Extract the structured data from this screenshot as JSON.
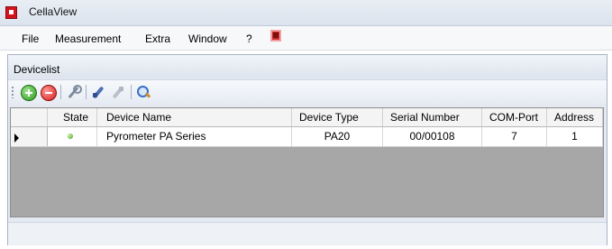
{
  "window": {
    "title": "CellaView"
  },
  "menu": {
    "items": [
      {
        "label": "File"
      },
      {
        "label": "Measurement"
      },
      {
        "label": "Extra"
      },
      {
        "label": "Window"
      },
      {
        "label": "?"
      }
    ],
    "app_icon": "cellaview-red-icon"
  },
  "panel": {
    "title": "Devicelist"
  },
  "toolbar": {
    "buttons": [
      {
        "icon": "add-icon",
        "tooltip": ""
      },
      {
        "icon": "remove-icon"
      },
      {
        "icon": "wrench-icon"
      },
      {
        "icon": "connect-icon"
      },
      {
        "icon": "disconnect-icon"
      },
      {
        "icon": "search-icon"
      }
    ]
  },
  "grid": {
    "columns": [
      "State",
      "Device Name",
      "Device Type",
      "Serial Number",
      "COM-Port",
      "Address"
    ],
    "rows": [
      {
        "state": "online",
        "device_name": "Pyrometer PA Series",
        "device_type": "PA20",
        "serial_number": "00/00108",
        "com_port": "7",
        "address": "1"
      }
    ]
  },
  "colors": {
    "state_ok": "#4c9a1c",
    "panel_bg": "#e4e9f2",
    "grid_empty": "#a7a7a7"
  }
}
